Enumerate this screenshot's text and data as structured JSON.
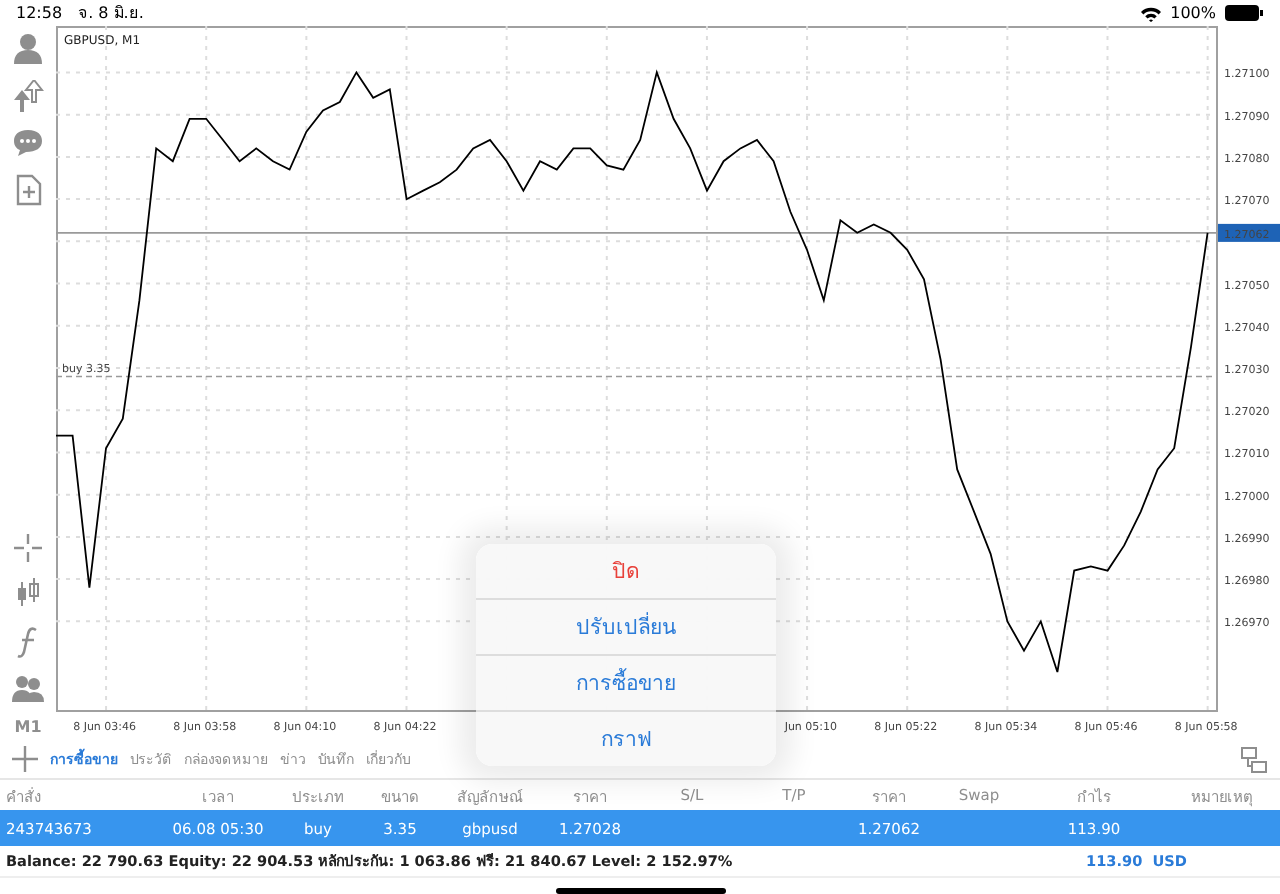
{
  "status_bar": {
    "time": "12:58",
    "date": "จ. 8 มิ.ย.",
    "battery": "100%"
  },
  "toolbar": {
    "timeframe": "M1"
  },
  "chart": {
    "chart_data": {
      "type": "line",
      "grid": true,
      "categories": [
        null,
        null,
        null,
        "8 Jun 03:46",
        null,
        null,
        null,
        null,
        null,
        "8 Jun 03:58",
        null,
        null,
        null,
        null,
        null,
        "8 Jun 04:10",
        null,
        null,
        null,
        null,
        null,
        "8 Jun 04:22",
        null,
        null,
        null,
        null,
        null,
        null,
        null,
        null,
        null,
        null,
        null,
        null,
        null,
        null,
        null,
        null,
        null,
        null,
        null,
        null,
        null,
        null,
        null,
        "Jun 05:10",
        null,
        null,
        null,
        null,
        null,
        "8 Jun 05:22",
        null,
        null,
        null,
        null,
        null,
        "8 Jun 05:34",
        null,
        null,
        null,
        null,
        null,
        "8 Jun 05:46",
        null,
        null,
        null,
        null,
        null,
        "8 Jun 05:58"
      ],
      "series": [
        {
          "name": "GBPUSD, M1",
          "color": "#000000",
          "values": [
            1.27014,
            1.27014,
            1.26978,
            1.27011,
            1.27018,
            1.27046,
            1.27082,
            1.27079,
            1.27089,
            1.27089,
            1.27084,
            1.27079,
            1.27082,
            1.27079,
            1.27077,
            1.27086,
            1.27091,
            1.27093,
            1.271,
            1.27094,
            1.27096,
            1.2707,
            1.27072,
            1.27074,
            1.27077,
            1.27082,
            1.27084,
            1.27079,
            1.27072,
            1.27079,
            1.27077,
            1.27082,
            1.27082,
            1.27078,
            1.27077,
            1.27084,
            1.271,
            1.27089,
            1.27082,
            1.27072,
            1.27079,
            1.27082,
            1.27084,
            1.27079,
            1.27067,
            1.27058,
            1.27046,
            1.27065,
            1.27062,
            1.27064,
            1.27062,
            1.27058,
            1.27051,
            1.27032,
            1.27006,
            1.26996,
            1.26986,
            1.2697,
            1.26963,
            1.2697,
            1.26958,
            1.26982,
            1.26983,
            1.26982,
            1.26988,
            1.26996,
            1.27006,
            1.27011,
            1.27035,
            1.27062
          ]
        }
      ],
      "ylim": [
        1.26949,
        1.27111
      ],
      "yticks": [
        {
          "value": 1.2697,
          "label": "1.26970"
        },
        {
          "value": 1.2698,
          "label": "1.26980"
        },
        {
          "value": 1.2699,
          "label": "1.26990"
        },
        {
          "value": 1.27,
          "label": "1.27000"
        },
        {
          "value": 1.2701,
          "label": "1.27010"
        },
        {
          "value": 1.2702,
          "label": "1.27020"
        },
        {
          "value": 1.2703,
          "label": "1.27030"
        },
        {
          "value": 1.2704,
          "label": "1.27040"
        },
        {
          "value": 1.2705,
          "label": "1.27050"
        },
        {
          "value": 1.2707,
          "label": "1.27070"
        },
        {
          "value": 1.2708,
          "label": "1.27080"
        },
        {
          "value": 1.2709,
          "label": "1.27090"
        },
        {
          "value": 1.271,
          "label": "1.27100"
        }
      ],
      "ref_lines": [
        {
          "axis": "y",
          "value": 1.27062,
          "label": "1.27062"
        },
        {
          "axis": "y",
          "value": 1.27028,
          "label": "buy 3.35"
        }
      ]
    }
  },
  "popup_menu": [
    {
      "label": "ปิด",
      "kind": "destructive"
    },
    {
      "label": "ปรับเปลี่ยน",
      "kind": "action"
    },
    {
      "label": "การซื้อขาย",
      "kind": "action"
    },
    {
      "label": "กราฟ",
      "kind": "action"
    }
  ],
  "tabs": [
    {
      "label": "การซื้อขาย",
      "selected": true
    },
    {
      "label": "ประวัติ",
      "selected": false
    },
    {
      "label": "กล่องจดหมาย",
      "selected": false
    },
    {
      "label": "ข่าว",
      "selected": false
    },
    {
      "label": "บันทึก",
      "selected": false
    },
    {
      "label": "เกี่ยวกับ",
      "selected": false
    }
  ],
  "table": {
    "columns": [
      "คำสั่ง",
      "เวลา",
      "ประเภท",
      "ขนาด",
      "สัญลักษณ์",
      "ราคา",
      "S/L",
      "T/P",
      "ราคา",
      "Swap",
      "กำไร",
      "หมายเหตุ"
    ],
    "rows": [
      {
        "selected": true,
        "cells": [
          "243743673",
          "06.08 05:30",
          "buy",
          "3.35",
          "gbpusd",
          "1.27028",
          "",
          "",
          "1.27062",
          "",
          "113.90",
          ""
        ]
      }
    ]
  },
  "summary": {
    "text": "Balance: 22 790.63 Equity: 22 904.53 หลักประกัน: 1 063.86 ฟรี: 21 840.67 Level: 2 152.97%",
    "profit": "113.90  USD"
  }
}
